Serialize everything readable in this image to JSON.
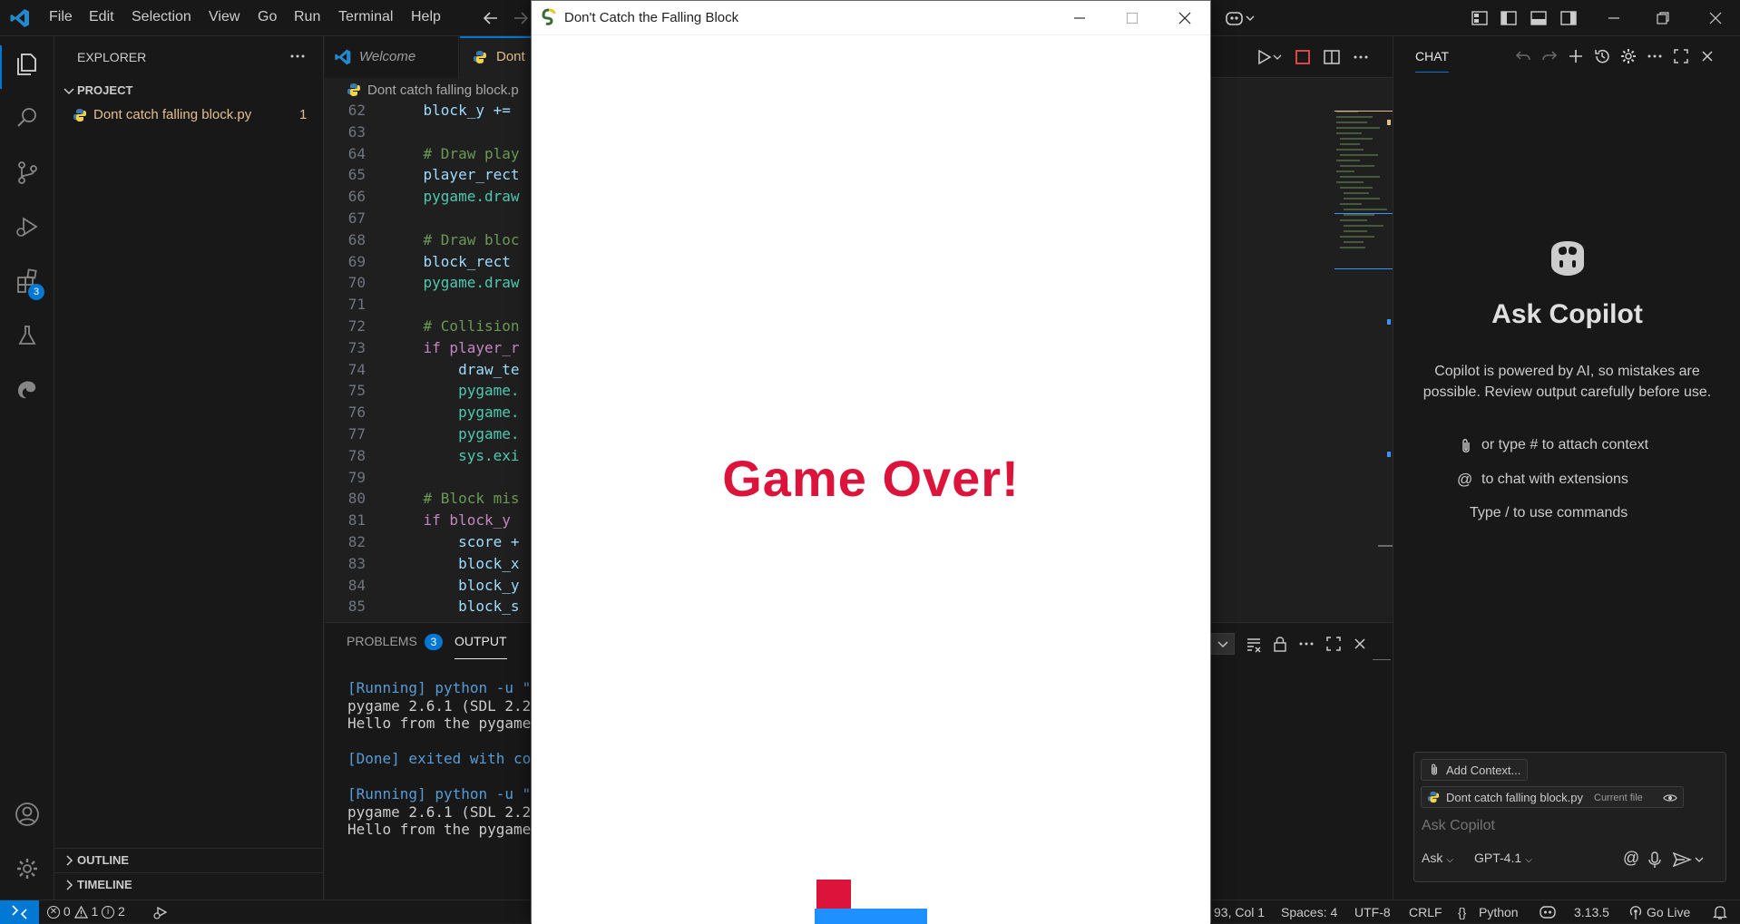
{
  "menu": [
    "File",
    "Edit",
    "Selection",
    "View",
    "Go",
    "Run",
    "Terminal",
    "Help"
  ],
  "activity_badge": "3",
  "explorer": {
    "title": "EXPLORER",
    "project": "PROJECT",
    "file": "Dont catch falling block.py",
    "file_problems": "1",
    "outline": "OUTLINE",
    "timeline": "TIMELINE"
  },
  "tabs": {
    "welcome": "Welcome",
    "active": "Dont"
  },
  "breadcrumb": "Dont catch falling block.p",
  "code": [
    {
      "n": "62",
      "t": "    block_y +="
    },
    {
      "n": "63",
      "t": ""
    },
    {
      "n": "64",
      "t": "    # Draw play"
    },
    {
      "n": "65",
      "t": "    player_rect"
    },
    {
      "n": "66",
      "t": "    pygame.draw"
    },
    {
      "n": "67",
      "t": ""
    },
    {
      "n": "68",
      "t": "    # Draw bloc"
    },
    {
      "n": "69",
      "t": "    block_rect"
    },
    {
      "n": "70",
      "t": "    pygame.draw"
    },
    {
      "n": "71",
      "t": ""
    },
    {
      "n": "72",
      "t": "    # Collision"
    },
    {
      "n": "73",
      "t": "    if player_r"
    },
    {
      "n": "74",
      "t": "        draw_te"
    },
    {
      "n": "75",
      "t": "        pygame."
    },
    {
      "n": "76",
      "t": "        pygame."
    },
    {
      "n": "77",
      "t": "        pygame."
    },
    {
      "n": "78",
      "t": "        sys.exi"
    },
    {
      "n": "79",
      "t": ""
    },
    {
      "n": "80",
      "t": "    # Block mis"
    },
    {
      "n": "81",
      "t": "    if block_y"
    },
    {
      "n": "82",
      "t": "        score +"
    },
    {
      "n": "83",
      "t": "        block_x"
    },
    {
      "n": "84",
      "t": "        block_y"
    },
    {
      "n": "85",
      "t": "        block_s"
    }
  ],
  "panel": {
    "problems": "PROBLEMS",
    "problems_count": "3",
    "output": "OUTPUT",
    "lines": [
      "[Running] python -u \"",
      "pygame 2.6.1 (SDL 2.2",
      "Hello from the pygame",
      "",
      "[Done] exited with co",
      "",
      "[Running] python -u \"",
      "pygame 2.6.1 (SDL 2.2",
      "Hello from the pygame"
    ]
  },
  "chat": {
    "tab": "CHAT",
    "heading": "Ask Copilot",
    "disclaimer": "Copilot is powered by AI, so mistakes are possible. Review output carefully before use.",
    "hint_attach": "or type # to attach context",
    "hint_ext": "to chat with extensions",
    "hint_cmd": "Type / to use commands",
    "add_context": "Add Context...",
    "context_file": "Dont catch falling block.py",
    "current_file": "Current file",
    "placeholder": "Ask Copilot",
    "mode": "Ask",
    "model": "GPT-4.1"
  },
  "status": {
    "errors": "0",
    "warnings": "1",
    "infos": "2",
    "position": "93, Col 1",
    "spaces": "Spaces: 4",
    "encoding": "UTF-8",
    "eol": "CRLF",
    "language": "Python",
    "version": "3.13.5",
    "golive": "Go Live"
  },
  "game_window": {
    "title": "Don't Catch the Falling Block",
    "message": "Game Over!",
    "message_color": "#dc143c",
    "block_color": "#dc143c",
    "player_color": "#1e90ff"
  }
}
